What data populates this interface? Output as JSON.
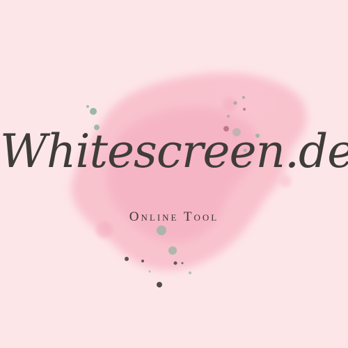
{
  "logo": {
    "wordmark": "Whitescreen.dev",
    "tagline": "Online Tool"
  },
  "colors": {
    "background": "#fde6e8",
    "watercolor": "#f7b7c6",
    "text": "#3f3c3a",
    "dot_green": "#8fb39e",
    "dot_dark": "#3e3a38"
  }
}
